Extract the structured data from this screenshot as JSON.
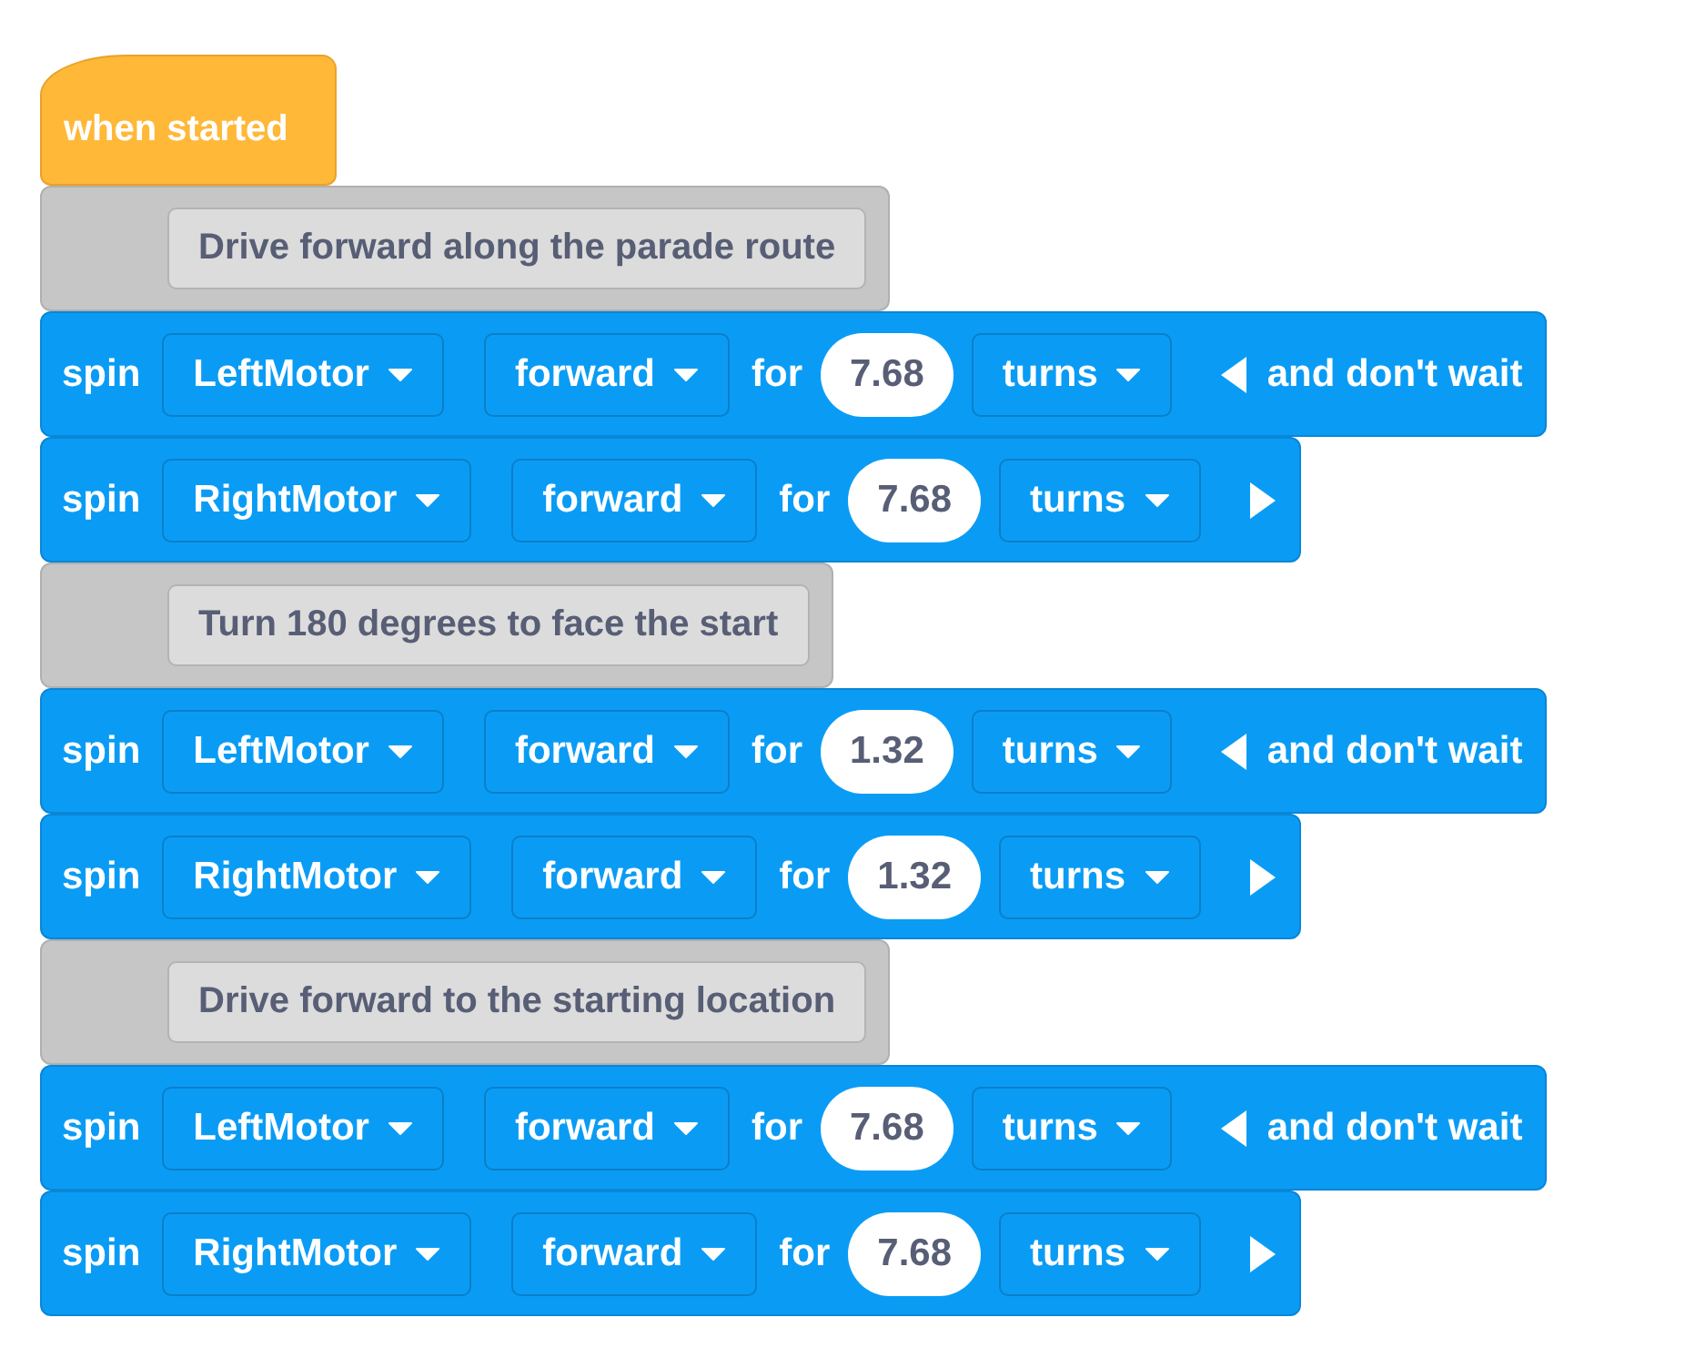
{
  "hat": {
    "label": "when started"
  },
  "blocks": [
    {
      "kind": "comment",
      "text": "Drive forward along the parade route"
    },
    {
      "kind": "spin",
      "label": "spin",
      "motor": "LeftMotor",
      "direction": "forward",
      "for_label": "for",
      "amount": "7.68",
      "unit": "turns",
      "expanded": true,
      "wait_text": "and don't wait"
    },
    {
      "kind": "spin",
      "label": "spin",
      "motor": "RightMotor",
      "direction": "forward",
      "for_label": "for",
      "amount": "7.68",
      "unit": "turns",
      "expanded": false
    },
    {
      "kind": "comment",
      "text": "Turn 180 degrees to face the start"
    },
    {
      "kind": "spin",
      "label": "spin",
      "motor": "LeftMotor",
      "direction": "forward",
      "for_label": "for",
      "amount": "1.32",
      "unit": "turns",
      "expanded": true,
      "wait_text": "and don't wait"
    },
    {
      "kind": "spin",
      "label": "spin",
      "motor": "RightMotor",
      "direction": "forward",
      "for_label": "for",
      "amount": "1.32",
      "unit": "turns",
      "expanded": false
    },
    {
      "kind": "comment",
      "text": "Drive forward to the starting location"
    },
    {
      "kind": "spin",
      "label": "spin",
      "motor": "LeftMotor",
      "direction": "forward",
      "for_label": "for",
      "amount": "7.68",
      "unit": "turns",
      "expanded": true,
      "wait_text": "and don't wait"
    },
    {
      "kind": "spin",
      "label": "spin",
      "motor": "RightMotor",
      "direction": "forward",
      "for_label": "for",
      "amount": "7.68",
      "unit": "turns",
      "expanded": false
    }
  ]
}
